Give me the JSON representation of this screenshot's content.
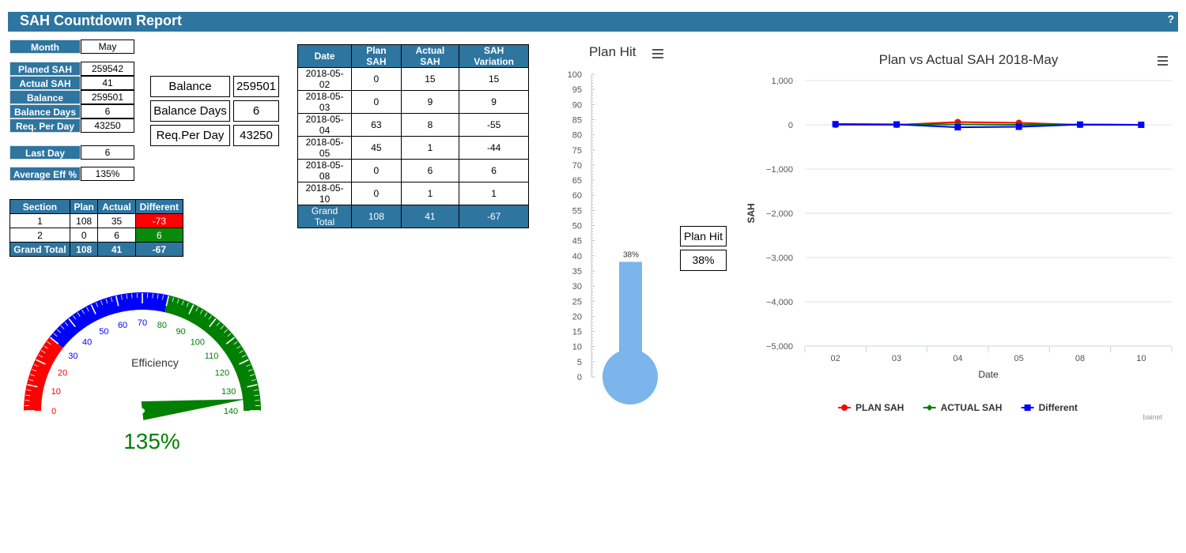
{
  "header": {
    "title": "SAH Countdown Report",
    "help": "?"
  },
  "month": {
    "label": "Month",
    "value": "May"
  },
  "summary": [
    {
      "label": "Planed SAH",
      "value": "259542"
    },
    {
      "label": "Actual SAH",
      "value": "41"
    },
    {
      "label": "Balance",
      "value": "259501"
    },
    {
      "label": "Balance Days",
      "value": "6"
    },
    {
      "label": "Req. Per Day",
      "value": "43250"
    }
  ],
  "last_day": {
    "label": "Last Day",
    "value": "6"
  },
  "avg_eff": {
    "label": "Average Eff %",
    "value": "135%"
  },
  "big_boxes": [
    {
      "label": "Balance",
      "value": "259501"
    },
    {
      "label": "Balance Days",
      "value": "6"
    },
    {
      "label": "Req.Per Day",
      "value": "43250"
    }
  ],
  "daily_table": {
    "headers": [
      "Date",
      "Plan SAH",
      "Actual SAH",
      "SAH Variation"
    ],
    "rows": [
      [
        "2018-05-02",
        "0",
        "15",
        "15"
      ],
      [
        "2018-05-03",
        "0",
        "9",
        "9"
      ],
      [
        "2018-05-04",
        "63",
        "8",
        "-55"
      ],
      [
        "2018-05-05",
        "45",
        "1",
        "-44"
      ],
      [
        "2018-05-08",
        "0",
        "6",
        "6"
      ],
      [
        "2018-05-10",
        "0",
        "1",
        "1"
      ]
    ],
    "total": [
      "Grand Total",
      "108",
      "41",
      "-67"
    ]
  },
  "section_table": {
    "headers": [
      "Section",
      "Plan",
      "Actual",
      "Different"
    ],
    "rows": [
      [
        "1",
        "108",
        "35",
        "-73"
      ],
      [
        "2",
        "0",
        "6",
        "6"
      ]
    ],
    "total": [
      "Grand Total",
      "108",
      "41",
      "-67"
    ]
  },
  "gauge": {
    "label": "Efficiency",
    "value": 135,
    "value_text": "135%",
    "ticks": [
      "0",
      "10",
      "20",
      "30",
      "40",
      "50",
      "60",
      "70",
      "80",
      "90",
      "100",
      "110",
      "120",
      "130",
      "140"
    ],
    "colors": {
      "low": "#ff0000",
      "mid": "#0000ff",
      "high": "#008000"
    }
  },
  "plan_hit": {
    "title": "Plan Hit",
    "value": 38,
    "value_text": "38%",
    "box_label": "Plan Hit",
    "box_value": "38%",
    "axis_ticks": [
      "0",
      "5",
      "10",
      "15",
      "20",
      "25",
      "30",
      "35",
      "40",
      "45",
      "50",
      "55",
      "60",
      "65",
      "70",
      "75",
      "80",
      "85",
      "90",
      "95",
      "100"
    ],
    "color": "#7cb5ec"
  },
  "chart_data": {
    "type": "line",
    "title": "Plan vs Actual SAH 2018-May",
    "xlabel": "Date",
    "ylabel": "SAH",
    "categories": [
      "02",
      "03",
      "04",
      "05",
      "08",
      "10"
    ],
    "yticks": [
      "1,000",
      "0",
      "−1,000",
      "−2,000",
      "−3,000",
      "−4,000",
      "−5,000"
    ],
    "ylim": [
      -5000,
      1000
    ],
    "grid": true,
    "legend_position": "bottom",
    "series": [
      {
        "name": "PLAN SAH",
        "color": "#ff0000",
        "marker": "circle",
        "values": [
          0,
          0,
          63,
          45,
          0,
          0
        ]
      },
      {
        "name": "ACTUAL SAH",
        "color": "#008000",
        "marker": "diamond",
        "values": [
          15,
          9,
          8,
          1,
          6,
          1
        ]
      },
      {
        "name": "Different",
        "color": "#0000ff",
        "marker": "square",
        "values": [
          15,
          9,
          -55,
          -44,
          6,
          1
        ]
      }
    ],
    "credit": "bainet"
  }
}
